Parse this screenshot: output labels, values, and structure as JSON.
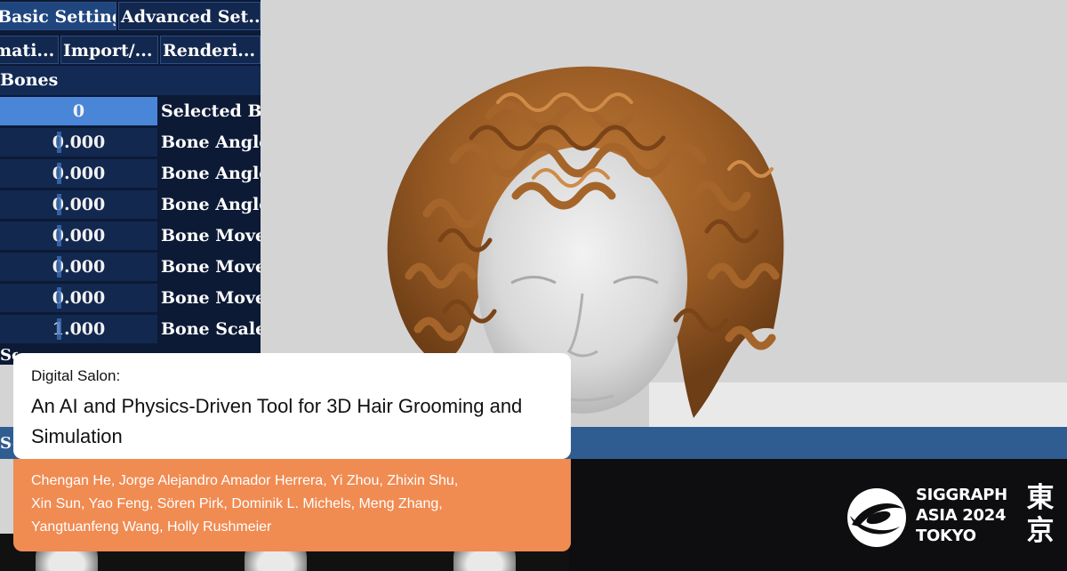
{
  "settings_panel": {
    "tabs_row1": [
      "Basic Settings",
      "Advanced Set..."
    ],
    "tabs_row2": [
      "mati...",
      "Import/...",
      "Renderi..."
    ],
    "section": "Bones",
    "rows": [
      {
        "value": "0",
        "label": "Selected Bo",
        "selected": true
      },
      {
        "value": "0.000",
        "label": "Bone Angle"
      },
      {
        "value": "0.000",
        "label": "Bone Angle"
      },
      {
        "value": "0.000",
        "label": "Bone Angle"
      },
      {
        "value": "0.000",
        "label": "Bone Move"
      },
      {
        "value": "0.000",
        "label": "Bone Move"
      },
      {
        "value": "0.000",
        "label": "Bone Move"
      },
      {
        "value": "1.000",
        "label": "Bone Scale"
      }
    ],
    "truncated_label_1": "Se",
    "truncated_label_2": "Se"
  },
  "title_card": {
    "kicker": "Digital Salon:",
    "title": "An AI and Physics-Driven Tool for 3D Hair Grooming and Simulation",
    "authors_line1": "Chengan He, Jorge Alejandro Amador Herrera, Yi Zhou, Zhixin Shu,",
    "authors_line2": "Xin Sun, Yao Feng, Sören Pirk, Dominik L. Michels, Meng Zhang,",
    "authors_line3": "Yangtuanfeng Wang, Holly Rushmeier"
  },
  "logo": {
    "line1": "SIGGRAPH",
    "line2": "ASIA 2024",
    "line3": "TOKYO",
    "kanji1": "東",
    "kanji2": "京"
  },
  "colors": {
    "panel_bg": "#0c1a36",
    "field_bg": "#13284f",
    "selected_field": "#4a86d8",
    "bottom_bar": "#2f5d92",
    "card_orange": "#f08b52",
    "hair": "#a5652a"
  }
}
